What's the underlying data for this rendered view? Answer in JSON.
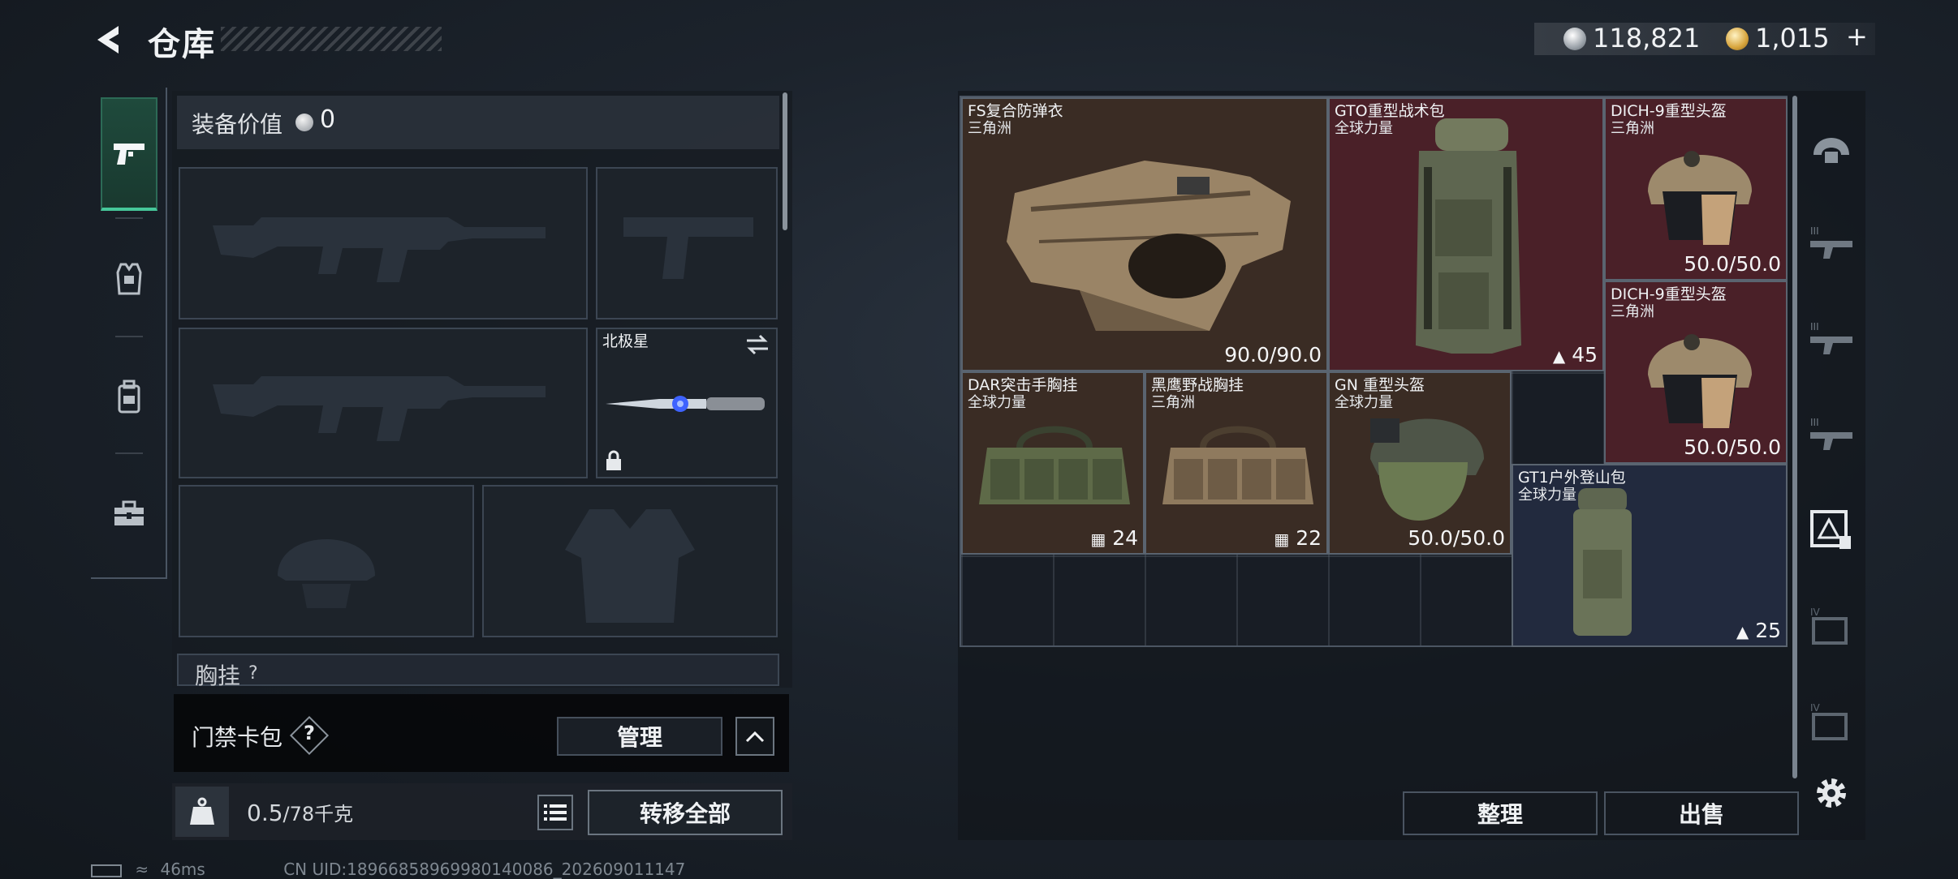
{
  "header": {
    "title": "仓库",
    "currency_primary": "118,821",
    "currency_secondary": "1,015",
    "currency_plus": "+"
  },
  "left_tabs": [
    {
      "name": "weapons",
      "icon": "pistol-icon",
      "active": true
    },
    {
      "name": "armor",
      "icon": "vest-icon",
      "active": false
    },
    {
      "name": "backpack",
      "icon": "backpack-icon",
      "active": false
    },
    {
      "name": "toolbox",
      "icon": "toolbox-icon",
      "active": false
    }
  ],
  "equipment": {
    "value_label": "装备价值",
    "value": "0",
    "secondary_weapon_name": "北极星",
    "chest_label": "胸挂",
    "chest_help": "?"
  },
  "keycard": {
    "label": "门禁卡包",
    "help": "?",
    "manage_label": "管理"
  },
  "weight": {
    "current": "0.5",
    "max": "/78千克",
    "icon_label": "KG",
    "transfer_all_label": "转移全部"
  },
  "stash": {
    "items": [
      {
        "name": "FS复合防弹衣",
        "sub": "三角洲",
        "value": "90.0/90.0",
        "type": "armor"
      },
      {
        "name": "GTO重型战术包",
        "sub": "全球力量",
        "value": "45",
        "value_icon": "backpack-small-icon",
        "type": "backpack"
      },
      {
        "name": "DICH-9重型头盔",
        "sub": "三角洲",
        "value": "50.0/50.0",
        "type": "helmet"
      },
      {
        "name": "DICH-9重型头盔",
        "sub": "三角洲",
        "value": "50.0/50.0",
        "type": "helmet"
      },
      {
        "name": "DAR突击手胸挂",
        "sub": "全球力量",
        "value": "24",
        "value_icon": "vest-small-icon",
        "type": "rig"
      },
      {
        "name": "黑鹰野战胸挂",
        "sub": "三角洲",
        "value": "22",
        "value_icon": "vest-small-icon",
        "type": "rig"
      },
      {
        "name": "GN 重型头盔",
        "sub": "全球力量",
        "value": "50.0/50.0",
        "type": "helmet"
      },
      {
        "name": "GT1户外登山包",
        "sub": "全球力量",
        "value": "25",
        "value_icon": "backpack-small-icon",
        "type": "backpack"
      }
    ],
    "sort_label": "整理",
    "sell_label": "出售"
  },
  "right_tabs": [
    {
      "icon": "helmet-tab-icon"
    },
    {
      "icon": "tier3-rifle-tab-icon",
      "tier": "III"
    },
    {
      "icon": "tier3-rifle-tab-icon",
      "tier": "III"
    },
    {
      "icon": "tier3-rifle-tab-icon",
      "tier": "III"
    },
    {
      "icon": "warning-box-tab-icon"
    },
    {
      "icon": "tier4-box-tab-icon",
      "tier": "IV"
    },
    {
      "icon": "tier4-box-tab-icon",
      "tier": "IV"
    }
  ],
  "status": {
    "ping": "46ms",
    "uid": "CN UID:18966858969980140086_202609011147"
  },
  "colors": {
    "accent_green": "#46c79a",
    "item_brown": "#3a2c24",
    "item_red": "#4a2028",
    "item_navy": "#222a3e"
  }
}
